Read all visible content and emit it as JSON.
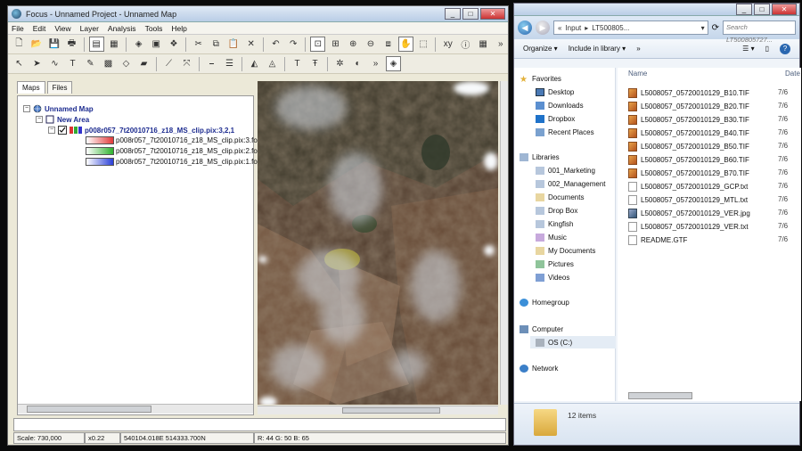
{
  "left_window": {
    "title": "Focus - Unnamed Project - Unnamed Map",
    "window_buttons": [
      "_",
      "□",
      "✕"
    ],
    "menu": [
      "File",
      "Edit",
      "View",
      "Layer",
      "Analysis",
      "Tools",
      "Help"
    ],
    "panel_tabs": [
      "Maps",
      "Files"
    ],
    "tree": {
      "map": "Unnamed Map",
      "area": "New Area",
      "layer": "p008r057_7t20010716_z18_MS_clip.pix:3,2,1",
      "channels": [
        {
          "label": "p008r057_7t20010716_z18_MS_clip.pix:3.foc",
          "color": "#e23a3a"
        },
        {
          "label": "p008r057_7t20010716_z18_MS_clip.pix:2.foc",
          "color": "#2fb32f"
        },
        {
          "label": "p008r057_7t20010716_z18_MS_clip.pix:1.foc",
          "color": "#2a3fd8"
        }
      ]
    },
    "status": {
      "scale": "Scale: 730,000",
      "zoom": "x0.22",
      "coords": "540104.018E 514333.700N",
      "rgb": "R: 44 G: 50 B: 65"
    }
  },
  "right_window": {
    "window_buttons": [
      "_",
      "□",
      "✕"
    ],
    "address": {
      "root": "Input",
      "current": "LT500805..."
    },
    "search_placeholder": "Search LT500805727...",
    "commands": [
      "Organize ▾",
      "Include in library ▾",
      "»"
    ],
    "nav": {
      "favorites_header": "Favorites",
      "favorites": [
        "Desktop",
        "Downloads",
        "Dropbox",
        "Recent Places"
      ],
      "libraries_header": "Libraries",
      "libraries": [
        "001_Marketing",
        "002_Management",
        "Documents",
        "Drop Box",
        "Kingfish",
        "Music",
        "My Documents",
        "Pictures",
        "Videos"
      ],
      "homegroup": "Homegroup",
      "computer_header": "Computer",
      "computer_items": [
        "OS (C:)"
      ],
      "network": "Network"
    },
    "columns": {
      "name": "Name",
      "date": "Date"
    },
    "files": [
      {
        "name": "L5008057_05720010129_B10.TIF",
        "type": "tif",
        "date": "7/6"
      },
      {
        "name": "L5008057_05720010129_B20.TIF",
        "type": "tif",
        "date": "7/6"
      },
      {
        "name": "L5008057_05720010129_B30.TIF",
        "type": "tif",
        "date": "7/6"
      },
      {
        "name": "L5008057_05720010129_B40.TIF",
        "type": "tif",
        "date": "7/6"
      },
      {
        "name": "L5008057_05720010129_B50.TIF",
        "type": "tif",
        "date": "7/6"
      },
      {
        "name": "L5008057_05720010129_B60.TIF",
        "type": "tif",
        "date": "7/6"
      },
      {
        "name": "L5008057_05720010129_B70.TIF",
        "type": "tif",
        "date": "7/6"
      },
      {
        "name": "L5008057_05720010129_GCP.txt",
        "type": "txt",
        "date": "7/6"
      },
      {
        "name": "L5008057_05720010129_MTL.txt",
        "type": "txt",
        "date": "7/6"
      },
      {
        "name": "L5008057_05720010129_VER.jpg",
        "type": "jpg",
        "date": "7/6"
      },
      {
        "name": "L5008057_05720010129_VER.txt",
        "type": "txt",
        "date": "7/6"
      },
      {
        "name": "README.GTF",
        "type": "txt",
        "date": "7/6"
      }
    ],
    "item_count": "12 items"
  }
}
